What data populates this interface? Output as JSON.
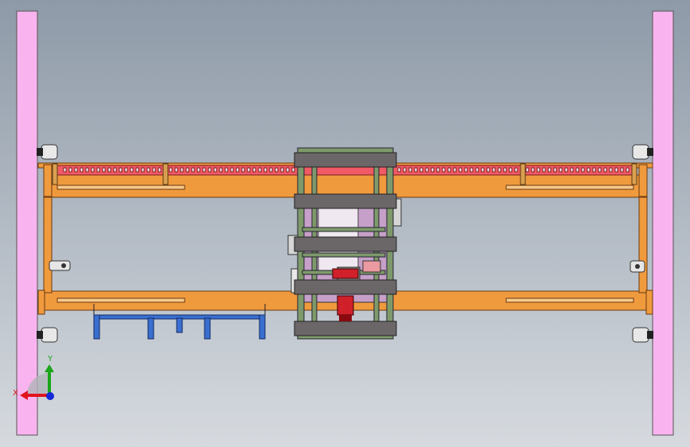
{
  "viewport": {
    "background_top": "#8e9aa8",
    "background_bottom": "#d6dadf"
  },
  "colors": {
    "rail": "#f9b4f0",
    "frame": "#f09a3e",
    "frame_light": "#f7c88a",
    "belt": "#f05a64",
    "carriage_plate": "#6b6668",
    "carriage_post": "#7f9a6a",
    "motor": "#d0202a",
    "bracket": "#3a6fd0",
    "roller": "#e8e8e8"
  },
  "triad": {
    "x_label": "X",
    "y_label": "Y",
    "x_color": "#e0141e",
    "y_color": "#1aa51a",
    "z_color": "#1428d8"
  }
}
